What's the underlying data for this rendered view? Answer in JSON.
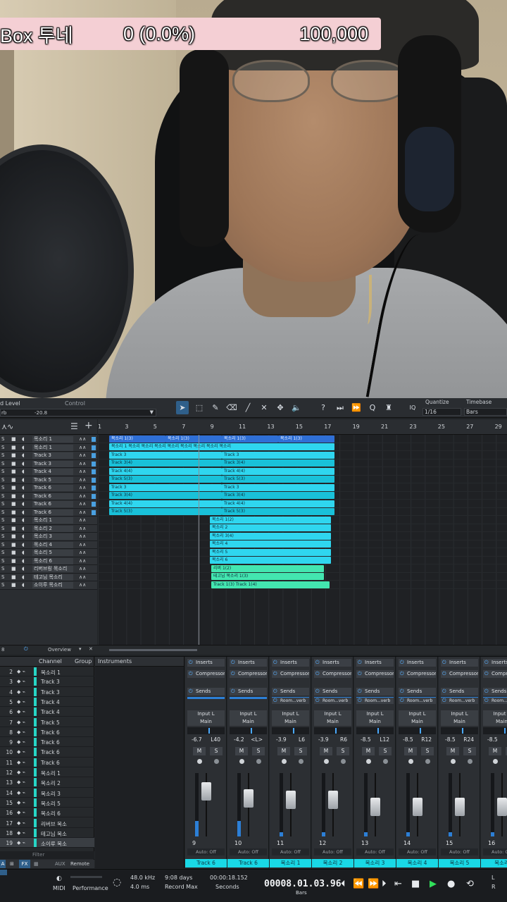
{
  "overlay": {
    "title": "Box 투네",
    "progress": "0 (0.0%)",
    "goal": "100,000"
  },
  "toolbar": {
    "input_level": "d Level",
    "control": "Control",
    "preset": "rb",
    "preset_value": "-20.8",
    "quantize_label": "Quantize",
    "quantize_value": "1/16",
    "timebase_label": "Timebase",
    "timebase_value": "Bars"
  },
  "ruler": [
    "1",
    "3",
    "5",
    "7",
    "9",
    "11",
    "13",
    "15",
    "17",
    "19",
    "21",
    "23",
    "25",
    "27",
    "29"
  ],
  "tracks": [
    "목소리 1",
    "목소리 1",
    "Track 3",
    "Track 3",
    "Track 4",
    "Track 5",
    "Track 6",
    "Track 6",
    "Track 6",
    "Track 6",
    "목소리 1",
    "목소리 2",
    "목소리 3",
    "목소리 4",
    "목소리 5",
    "목소리 6",
    "리버브링 목소리",
    "테고님 목소리",
    "소이루 목소리"
  ],
  "clips": [
    {
      "row": 0,
      "start": 0,
      "len": 80,
      "label": "목소리 1(3)",
      "cls": "blue"
    },
    {
      "row": 0,
      "start": 80,
      "len": 80,
      "label": "목소리 1(3)",
      "cls": "blue"
    },
    {
      "row": 0,
      "start": 160,
      "len": 80,
      "label": "목소리 1(3)",
      "cls": "blue"
    },
    {
      "row": 0,
      "start": 240,
      "len": 80,
      "label": "목소리 1(3)",
      "cls": "blue"
    },
    {
      "row": 1,
      "start": 0,
      "len": 320,
      "label": "목소리 1 목소리 목소리 목소리 목소리 목소리 목소리 목소리 목소리",
      "cls": "cyan"
    },
    {
      "row": 2,
      "start": 0,
      "len": 160,
      "label": "Track 3",
      "cls": "cyan"
    },
    {
      "row": 2,
      "start": 160,
      "len": 160,
      "label": "Track 3",
      "cls": "cyan"
    },
    {
      "row": 3,
      "start": 0,
      "len": 160,
      "label": "Track 3(4)",
      "cls": "cyan2"
    },
    {
      "row": 3,
      "start": 160,
      "len": 160,
      "label": "Track 3(4)",
      "cls": "cyan2"
    },
    {
      "row": 4,
      "start": 0,
      "len": 160,
      "label": "Track 4(4)",
      "cls": "cyan"
    },
    {
      "row": 4,
      "start": 160,
      "len": 160,
      "label": "Track 4(4)",
      "cls": "cyan"
    },
    {
      "row": 5,
      "start": 0,
      "len": 160,
      "label": "Track 5(3)",
      "cls": "cyan2"
    },
    {
      "row": 5,
      "start": 160,
      "len": 160,
      "label": "Track 5(3)",
      "cls": "cyan2"
    },
    {
      "row": 6,
      "start": 0,
      "len": 160,
      "label": "Track 3",
      "cls": "cyan"
    },
    {
      "row": 6,
      "start": 160,
      "len": 160,
      "label": "Track 3",
      "cls": "cyan"
    },
    {
      "row": 7,
      "start": 0,
      "len": 160,
      "label": "Track 3(4)",
      "cls": "cyan2"
    },
    {
      "row": 7,
      "start": 160,
      "len": 160,
      "label": "Track 3(4)",
      "cls": "cyan2"
    },
    {
      "row": 8,
      "start": 0,
      "len": 160,
      "label": "Track 4(4)",
      "cls": "cyan"
    },
    {
      "row": 8,
      "start": 160,
      "len": 160,
      "label": "Track 4(4)",
      "cls": "cyan"
    },
    {
      "row": 9,
      "start": 0,
      "len": 160,
      "label": "Track 5(3)",
      "cls": "cyan2"
    },
    {
      "row": 9,
      "start": 160,
      "len": 160,
      "label": "Track 5(3)",
      "cls": "cyan2"
    },
    {
      "row": 10,
      "start": 143,
      "len": 172,
      "label": "목소리 1(2)",
      "cls": "cyan"
    },
    {
      "row": 11,
      "start": 143,
      "len": 172,
      "label": "목소리 2",
      "cls": "cyan"
    },
    {
      "row": 12,
      "start": 143,
      "len": 172,
      "label": "목소리 3(4)",
      "cls": "cyan"
    },
    {
      "row": 13,
      "start": 143,
      "len": 172,
      "label": "목소리 4",
      "cls": "cyan"
    },
    {
      "row": 14,
      "start": 143,
      "len": 172,
      "label": "목소리 5",
      "cls": "cyan"
    },
    {
      "row": 15,
      "start": 143,
      "len": 172,
      "label": "목소리 6",
      "cls": "cyan"
    },
    {
      "row": 16,
      "start": 145,
      "len": 160,
      "label": "리버 1(2)",
      "cls": "green"
    },
    {
      "row": 17,
      "start": 145,
      "len": 160,
      "label": "테고님 목소리 1(3)",
      "cls": "green"
    },
    {
      "row": 18,
      "start": 145,
      "len": 168,
      "label": "Track 1(3)   Track 1(4)",
      "cls": "green"
    }
  ],
  "arr_bottom": {
    "overview": "Overview"
  },
  "mixer": {
    "channel_header": "Channel",
    "group_header": "Group",
    "instruments_header": "Instruments",
    "filter_placeholder": "Filter",
    "channels": [
      {
        "no": "2",
        "name": "목소리 1"
      },
      {
        "no": "3",
        "name": "Track 3"
      },
      {
        "no": "4",
        "name": "Track 3"
      },
      {
        "no": "5",
        "name": "Track 4"
      },
      {
        "no": "6",
        "name": "Track 4"
      },
      {
        "no": "7",
        "name": "Track 5"
      },
      {
        "no": "8",
        "name": "Track 6"
      },
      {
        "no": "9",
        "name": "Track 6"
      },
      {
        "no": "10",
        "name": "Track 6"
      },
      {
        "no": "11",
        "name": "Track 6"
      },
      {
        "no": "12",
        "name": "목소리 1"
      },
      {
        "no": "13",
        "name": "목소리 2"
      },
      {
        "no": "14",
        "name": "목소리 3"
      },
      {
        "no": "15",
        "name": "목소리 5"
      },
      {
        "no": "16",
        "name": "목소리 6"
      },
      {
        "no": "17",
        "name": "리버브 목소"
      },
      {
        "no": "18",
        "name": "테고님 목소"
      },
      {
        "no": "19",
        "name": "소이루 목소"
      }
    ],
    "bottom_tabs": [
      "FX",
      "AUX",
      "Remote"
    ],
    "strips": [
      {
        "num": "9",
        "vol": "-6.7",
        "pan": "L40",
        "name": "Track 6"
      },
      {
        "num": "10",
        "vol": "-4.2",
        "pan": "<L>",
        "name": "Track 6"
      },
      {
        "num": "11",
        "vol": "-3.9",
        "pan": "L6",
        "name": "목소리 1"
      },
      {
        "num": "12",
        "vol": "-3.9",
        "pan": "R6",
        "name": "목소리 2"
      },
      {
        "num": "13",
        "vol": "-8.5",
        "pan": "L12",
        "name": "목소리 3"
      },
      {
        "num": "14",
        "vol": "-8.5",
        "pan": "R12",
        "name": "목소리 4"
      },
      {
        "num": "15",
        "vol": "-8.5",
        "pan": "R24",
        "name": "목소리 5"
      },
      {
        "num": "16",
        "vol": "-8.5",
        "pan": "",
        "name": "목소리"
      }
    ],
    "inserts_label": "Inserts",
    "sends_label": "Sends",
    "compressor_label": "Compressor",
    "send_target": "Room...verb",
    "input_label": "Input L",
    "main_label": "Main",
    "auto_label": "Auto: Off"
  },
  "transport": {
    "midi": "MIDI",
    "performance": "Performance",
    "sample_rate": "48.0 kHz",
    "latency": "4.0 ms",
    "record_days": "9:08 days",
    "record_max": "Record Max",
    "seconds_time": "00:00:18.152",
    "seconds_label": "Seconds",
    "bars_time": "00008.01.03.96",
    "bars_label": "Bars"
  }
}
